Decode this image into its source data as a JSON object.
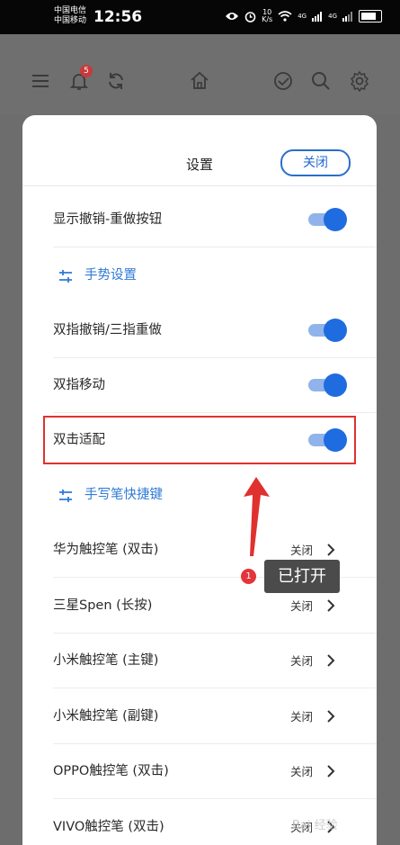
{
  "statusbar": {
    "carrier1": "中国电信",
    "carrier2": "中国移动",
    "time": "12:56",
    "speed_value": "10",
    "speed_unit": "K/s",
    "net1": "4G",
    "net2": "4G"
  },
  "appbar": {
    "badge": "5"
  },
  "sheet": {
    "title": "设置",
    "close_label": "关闭"
  },
  "rows": {
    "undo_redo": {
      "label": "显示撤销-重做按钮",
      "on": true
    },
    "gesture_section": {
      "label": "手势设置"
    },
    "two_finger_undo": {
      "label": "双指撤销/三指重做",
      "on": true
    },
    "two_finger_move": {
      "label": "双指移动",
      "on": true
    },
    "double_tap_fit": {
      "label": "双击适配",
      "on": true
    },
    "pen_section": {
      "label": "手写笔快捷键"
    },
    "huawei": {
      "label": "华为触控笔 (双击)",
      "value": "关闭"
    },
    "samsung": {
      "label": "三星Spen (长按)",
      "value": "关闭"
    },
    "xiaomi_main": {
      "label": "小米触控笔 (主键)",
      "value": "关闭"
    },
    "xiaomi_sub": {
      "label": "小米触控笔 (副键)",
      "value": "关闭"
    },
    "oppo": {
      "label": "OPPO触控笔 (双击)",
      "value": "关闭"
    },
    "vivo": {
      "label": "VIVO触控笔 (双击)",
      "value": "关闭"
    }
  },
  "annotation": {
    "number": "1",
    "text": "已打开"
  },
  "watermark": {
    "text": "Bai 经验"
  },
  "colors": {
    "accent": "#1f6ce0",
    "highlight": "#e0312e"
  }
}
